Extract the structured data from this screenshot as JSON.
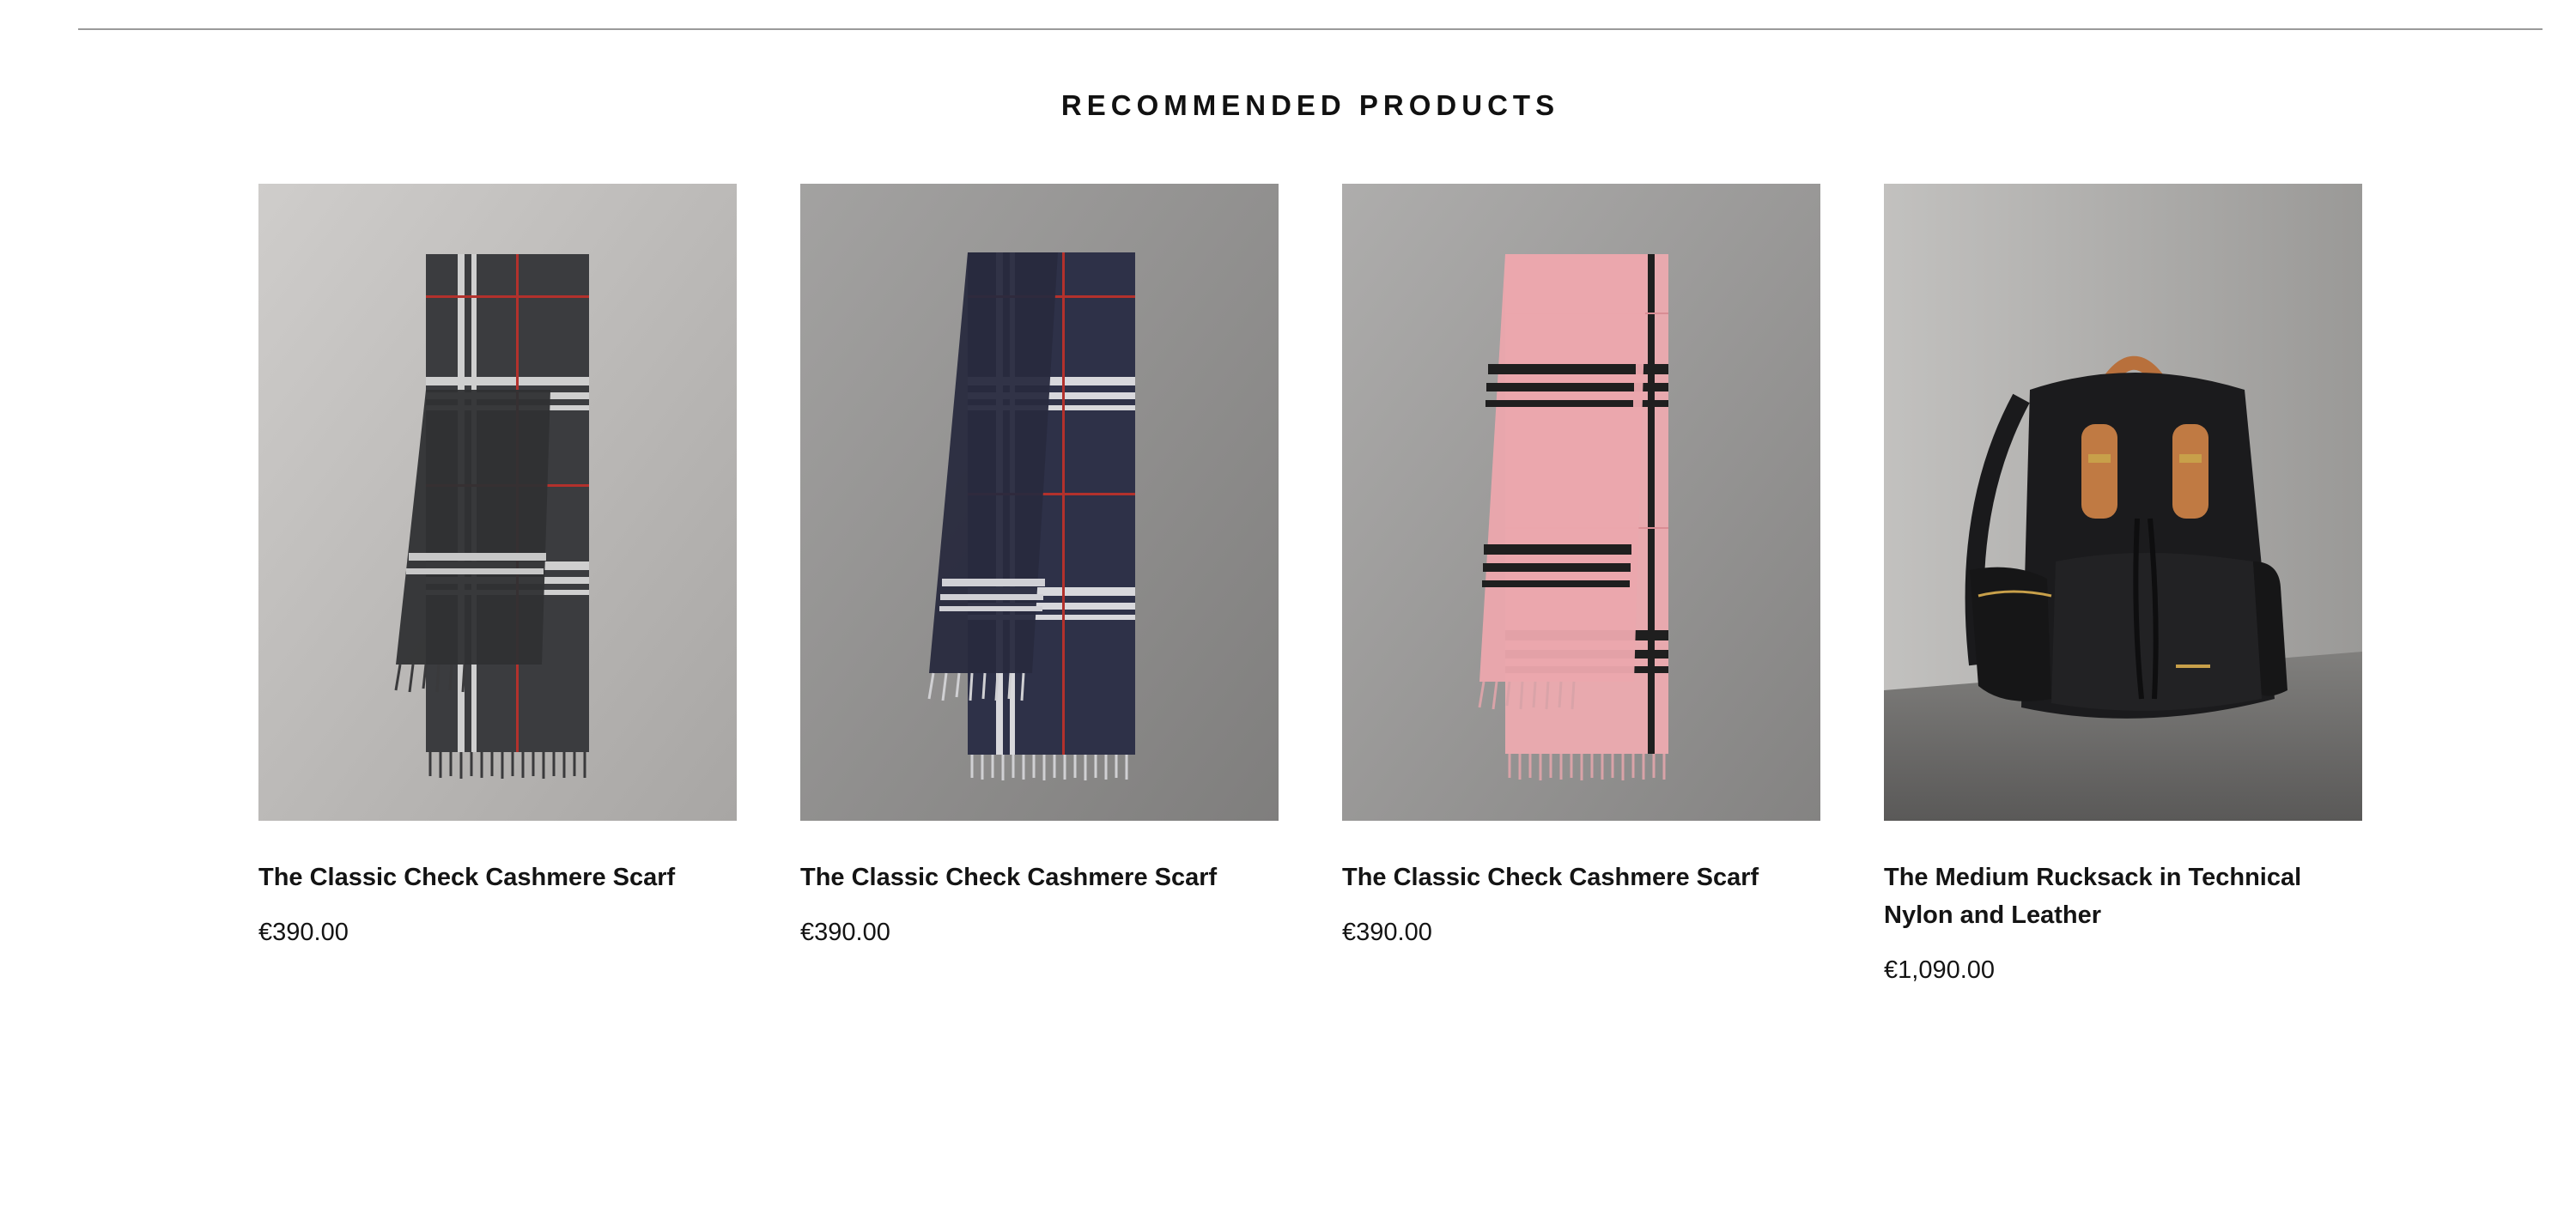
{
  "section": {
    "title": "RECOMMENDED PRODUCTS"
  },
  "products": [
    {
      "name": "The Classic Check Cashmere Scarf",
      "price": "€390.00",
      "image_icon": "charcoal-check-scarf-image",
      "colors": {
        "base": "#3b3c3f",
        "stripe": "#c9c9c9",
        "accent": "#b3312c",
        "wall": "#b9b7b5"
      }
    },
    {
      "name": "The Classic Check Cashmere Scarf",
      "price": "€390.00",
      "image_icon": "navy-check-scarf-image",
      "colors": {
        "base": "#2e3148",
        "stripe": "#d8d8dc",
        "accent": "#b3312c",
        "wall": "#8e8d8c"
      }
    },
    {
      "name": "The Classic Check Cashmere Scarf",
      "price": "€390.00",
      "image_icon": "pink-check-scarf-image",
      "colors": {
        "base": "#e8a9ae",
        "stripe": "#1f1f1f",
        "accent": "#d98d94",
        "wall": "#9c9b9a"
      }
    },
    {
      "name": "The Medium Rucksack in Technical Nylon and Leather",
      "price": "€1,090.00",
      "image_icon": "black-rucksack-image",
      "colors": {
        "base": "#1b1b1d",
        "stripe": "#c07a43",
        "accent": "#c8a04a",
        "wall": "#a8a7a5"
      }
    }
  ]
}
